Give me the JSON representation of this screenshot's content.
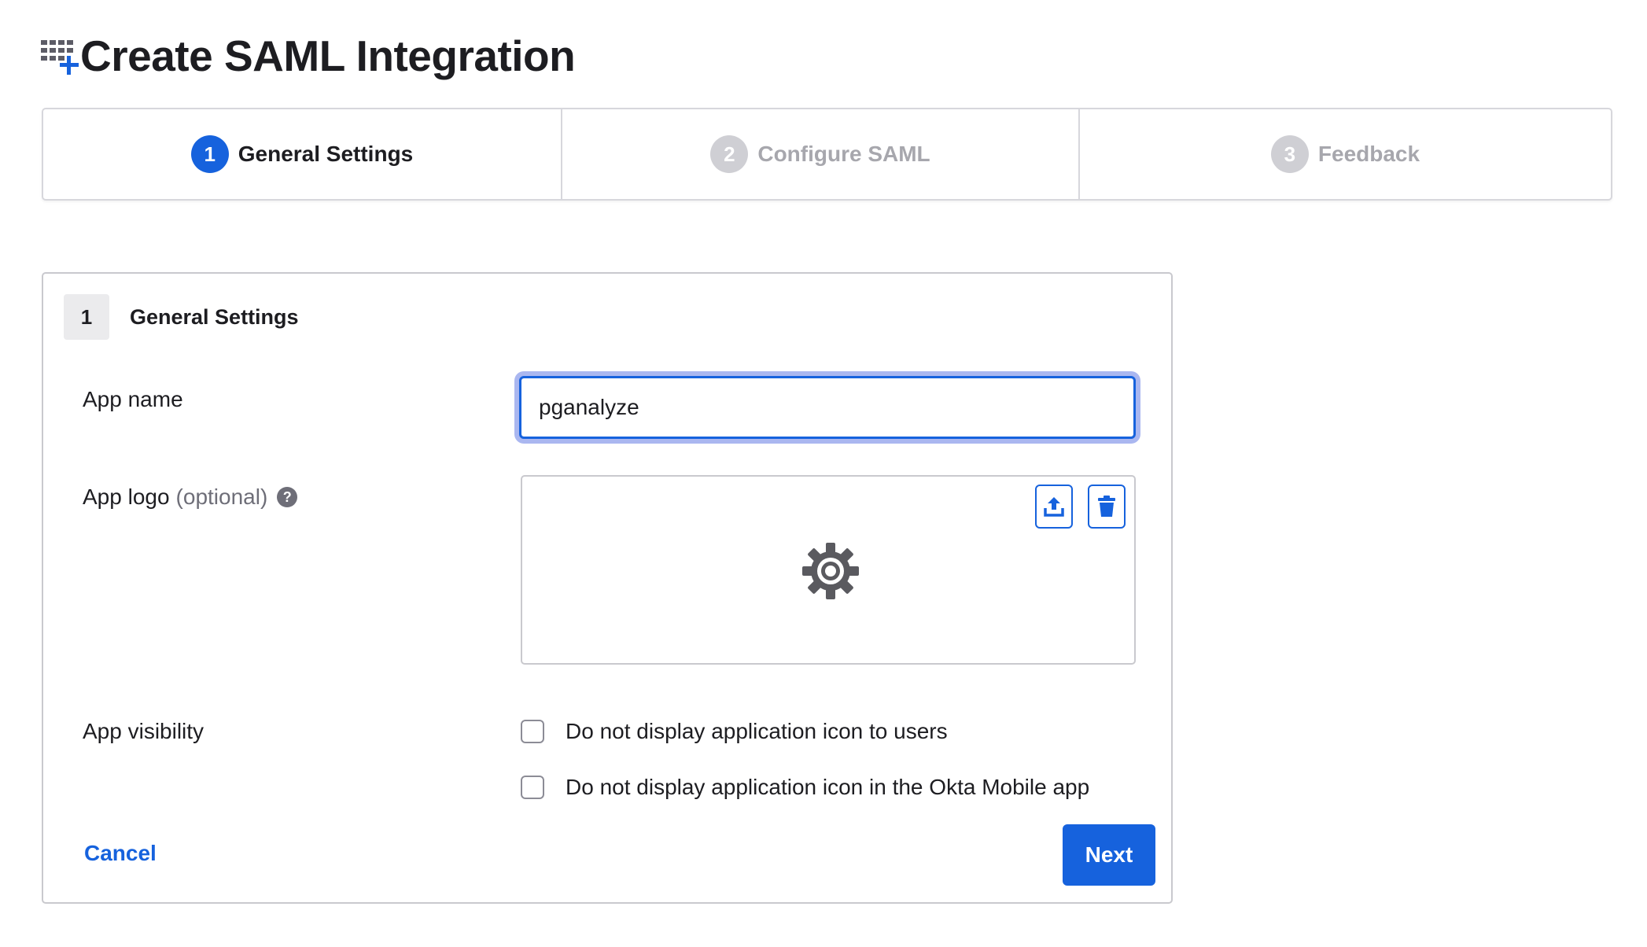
{
  "page": {
    "title": "Create SAML Integration",
    "icon": "app-grid-plus-icon"
  },
  "wizard": {
    "steps": [
      {
        "number": "1",
        "label": "General Settings",
        "state": "active"
      },
      {
        "number": "2",
        "label": "Configure SAML",
        "state": "inactive"
      },
      {
        "number": "3",
        "label": "Feedback",
        "state": "inactive"
      }
    ]
  },
  "section": {
    "number": "1",
    "title": "General Settings"
  },
  "fields": {
    "app_name": {
      "label": "App name",
      "value": "pganalyze"
    },
    "app_logo": {
      "label": "App logo",
      "optional": "(optional)",
      "help": "?",
      "placeholder_icon": "gear-icon"
    },
    "app_visibility": {
      "label": "App visibility",
      "options": [
        {
          "label": "Do not display application icon to users",
          "checked": false
        },
        {
          "label": "Do not display application icon in the Okta Mobile app",
          "checked": false
        }
      ]
    }
  },
  "actions": {
    "cancel": "Cancel",
    "next": "Next"
  },
  "colors": {
    "accent": "#1662dd",
    "inactive_step": "#cfcfd4",
    "focus_ring": "#aab7f0"
  }
}
